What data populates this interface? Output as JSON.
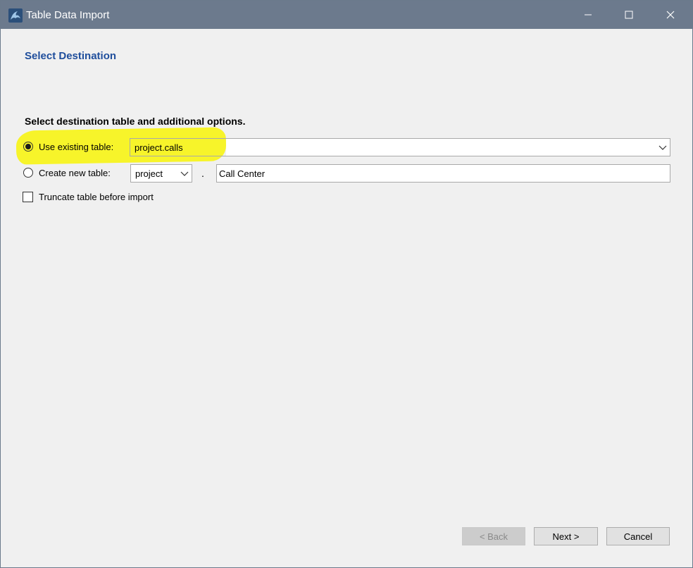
{
  "window": {
    "title": "Table Data Import",
    "controls": {
      "minimize": "minimize-icon",
      "maximize": "maximize-icon",
      "close": "close-icon"
    }
  },
  "page": {
    "heading": "Select Destination",
    "instructions": "Select destination table and additional options."
  },
  "options": {
    "use_existing": {
      "label": "Use existing table:",
      "selected": true,
      "value": "project.calls"
    },
    "create_new": {
      "label": "Create new table:",
      "selected": false,
      "schema_value": "project",
      "separator": ".",
      "table_name": "Call Center"
    },
    "truncate": {
      "label": "Truncate table before import",
      "checked": false
    }
  },
  "buttons": {
    "back": "< Back",
    "next": "Next >",
    "cancel": "Cancel"
  },
  "colors": {
    "titlebar": "#6c7a8d",
    "heading": "#1f4e9c",
    "highlight": "#f7f42a",
    "dialog_bg": "#f0f0f0"
  }
}
